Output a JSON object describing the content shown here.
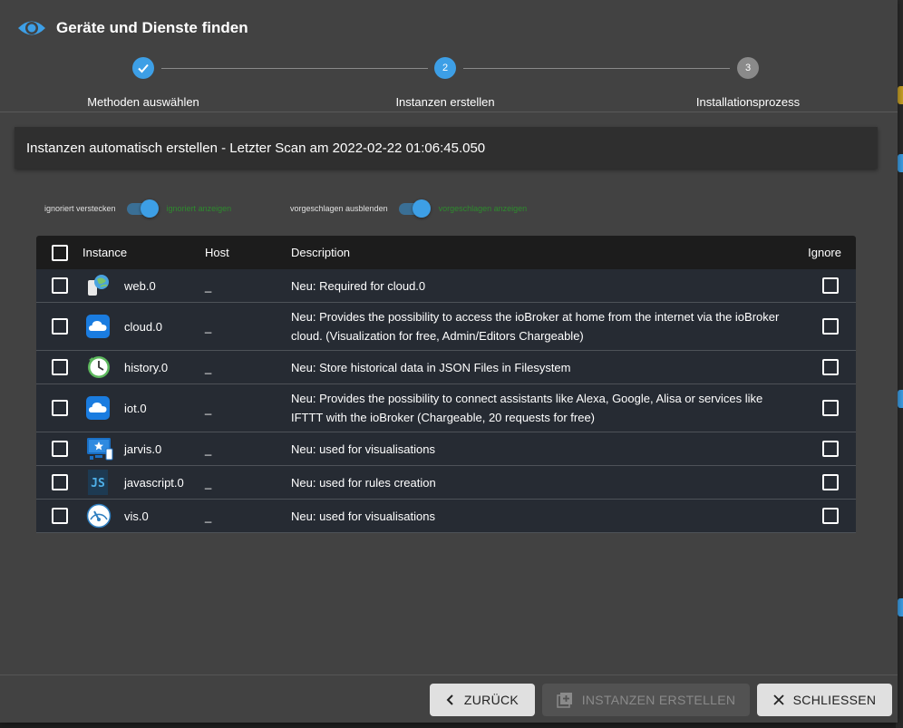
{
  "dialog": {
    "title": "Geräte und Dienste finden"
  },
  "stepper": {
    "steps": [
      {
        "label": "Methoden auswählen",
        "number": "1",
        "state": "done"
      },
      {
        "label": "Instanzen erstellen",
        "number": "2",
        "state": "active"
      },
      {
        "label": "Installationsprozess",
        "number": "3",
        "state": "pending"
      }
    ]
  },
  "banner": {
    "text": "Instanzen automatisch erstellen - Letzter Scan am 2022-02-22 01:06:45.050"
  },
  "switches": [
    {
      "off_label": "ignoriert verstecken",
      "on_label": "ignoriert anzeigen",
      "checked": true
    },
    {
      "off_label": "vorgeschlagen ausblenden",
      "on_label": "vorgeschlagen anzeigen",
      "checked": true
    }
  ],
  "table": {
    "headers": {
      "instance": "Instance",
      "host": "Host",
      "description": "Description",
      "ignore": "Ignore"
    },
    "rows": [
      {
        "icon": "web-icon",
        "instance": "web.0",
        "host": "_",
        "description": "Neu: Required for cloud.0"
      },
      {
        "icon": "cloud-icon",
        "instance": "cloud.0",
        "host": "_",
        "description": "Neu: Provides the possibility to access the ioBroker at home from the internet via the ioBroker cloud. (Visualization for free, Admin/Editors Chargeable)"
      },
      {
        "icon": "history-icon",
        "instance": "history.0",
        "host": "_",
        "description": "Neu: Store historical data in JSON Files in Filesystem"
      },
      {
        "icon": "iot-cloud-icon",
        "instance": "iot.0",
        "host": "_",
        "description": "Neu: Provides the possibility to connect assistants like Alexa, Google, Alisa or services like IFTTT with the ioBroker (Chargeable, 20 requests for free)"
      },
      {
        "icon": "jarvis-icon",
        "instance": "jarvis.0",
        "host": "_",
        "description": "Neu: used for visualisations"
      },
      {
        "icon": "javascript-icon",
        "instance": "javascript.0",
        "host": "_",
        "description": "Neu: used for rules creation"
      },
      {
        "icon": "vis-icon",
        "instance": "vis.0",
        "host": "_",
        "description": "Neu: used for visualisations"
      }
    ]
  },
  "footer": {
    "back_label": "ZURÜCK",
    "create_label": "INSTANZEN ERSTELLEN",
    "close_label": "SCHLIESSEN"
  },
  "colors": {
    "accent": "#3d9fe6",
    "dialog_bg": "#424242",
    "row_bg": "#262b33",
    "switch_on_label": "#2e8b2e"
  }
}
